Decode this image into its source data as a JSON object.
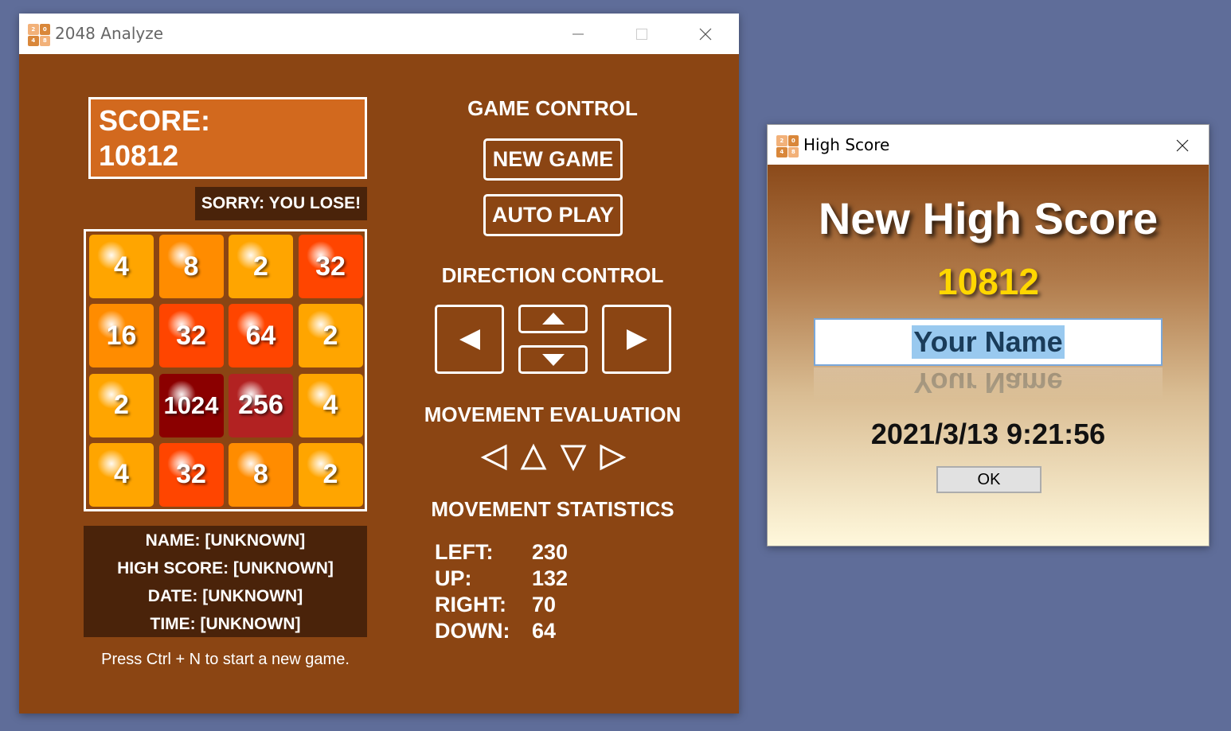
{
  "main_window": {
    "title": "2048 Analyze",
    "icon_digits": [
      "2",
      "0",
      "4",
      "8"
    ],
    "score_label": "SCORE:",
    "score_value": "10812",
    "status": "SORRY: YOU LOSE!",
    "board": [
      [
        "4",
        "8",
        "2",
        "32"
      ],
      [
        "16",
        "32",
        "64",
        "2"
      ],
      [
        "2",
        "1024",
        "256",
        "4"
      ],
      [
        "4",
        "32",
        "8",
        "2"
      ]
    ],
    "info": {
      "name": "NAME: [UNKNOWN]",
      "high_score": "HIGH SCORE: [UNKNOWN]",
      "date": "DATE: [UNKNOWN]",
      "time": "TIME: [UNKNOWN]"
    },
    "hint": "Press Ctrl + N to start a new game.",
    "game_control": {
      "title": "GAME CONTROL",
      "new_game": "NEW GAME",
      "auto_play": "AUTO PLAY"
    },
    "direction_control": {
      "title": "DIRECTION CONTROL",
      "icons": [
        "left-arrow-icon",
        "up-arrow-icon",
        "down-arrow-icon",
        "right-arrow-icon"
      ]
    },
    "movement_evaluation": {
      "title": "MOVEMENT EVALUATION",
      "icons": [
        "left-outline-arrow-icon",
        "up-outline-arrow-icon",
        "down-outline-arrow-icon",
        "right-outline-arrow-icon"
      ]
    },
    "movement_statistics": {
      "title": "MOVEMENT STATISTICS",
      "rows": [
        {
          "label": "LEFT:",
          "value": "230"
        },
        {
          "label": "UP:",
          "value": "132"
        },
        {
          "label": "RIGHT:",
          "value": "70"
        },
        {
          "label": "DOWN:",
          "value": "64"
        }
      ]
    },
    "colors": {
      "background": "#8b4513",
      "score_box": "#d2691e",
      "dark_panel": "#4a230a"
    }
  },
  "dialog": {
    "title": "High Score",
    "heading": "New High Score",
    "score": "10812",
    "name_value": "Your Name",
    "datetime": "2021/3/13 9:21:56",
    "ok_label": "OK"
  }
}
